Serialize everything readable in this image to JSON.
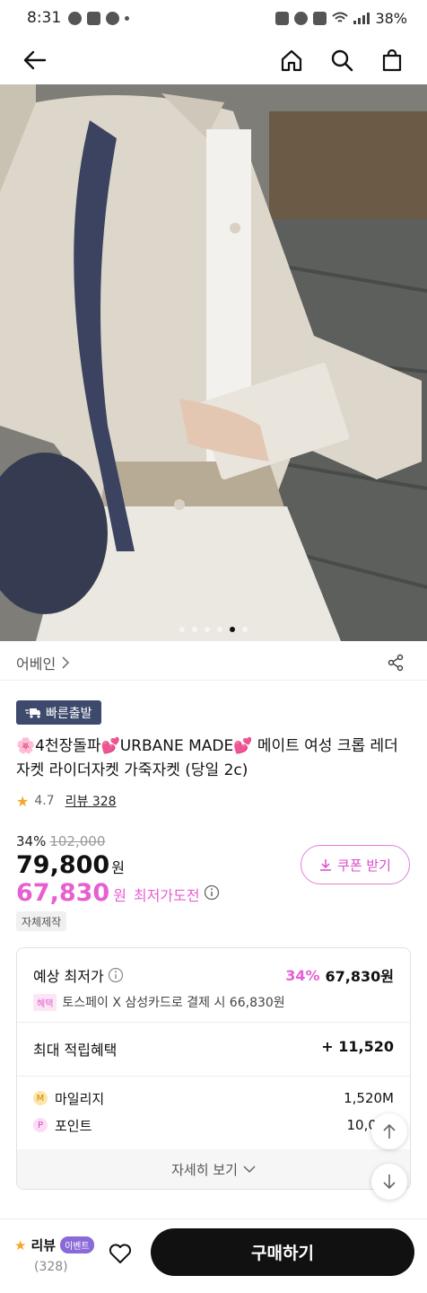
{
  "status_bar": {
    "time": "8:31",
    "battery": "38%"
  },
  "hero": {
    "active_index": 4,
    "dot_count": 6
  },
  "brand": {
    "name": "어베인"
  },
  "badges": {
    "fast_shipping": "빠른출발"
  },
  "product": {
    "title_prefix": "🌸4천장돌파",
    "title_heart": "💕",
    "title_brand": "URBANE MADE",
    "title_rest": " 메이트 여성 크롭 레더자켓 라이더자켓 가죽자켓 (당일 2c)",
    "rating": "4.7",
    "review_label": "리뷰 328"
  },
  "price": {
    "discount_rate": "34%",
    "original": "102,000",
    "sale": "79,800",
    "won": "원",
    "best": "67,830",
    "best_label": "최저가도전"
  },
  "coupon": {
    "label": "쿠폰 받기"
  },
  "tags": {
    "self_made": "자체제작"
  },
  "benefit": {
    "expected_label": "예상 최저가",
    "expected_rate": "34%",
    "expected_price": "67,830원",
    "card_tag": "혜택",
    "card_text": "토스페이 X 삼성카드로 결제 시 66,830원",
    "max_label": "최대 적립혜택",
    "max_value": "+ 11,520",
    "items": [
      {
        "icon": "M",
        "label": "마일리지",
        "value": "1,520M"
      },
      {
        "icon": "P",
        "label": "포인트",
        "value": "10,000"
      }
    ],
    "more_label": "자세히 보기"
  },
  "bottom": {
    "review_label": "리뷰",
    "event_badge": "이벤트",
    "review_count": "(328)",
    "buy_label": "구매하기"
  },
  "colors": {
    "accent": "#e75fd0",
    "badge_bg": "#3d4a6b",
    "buy_bg": "#111111"
  }
}
